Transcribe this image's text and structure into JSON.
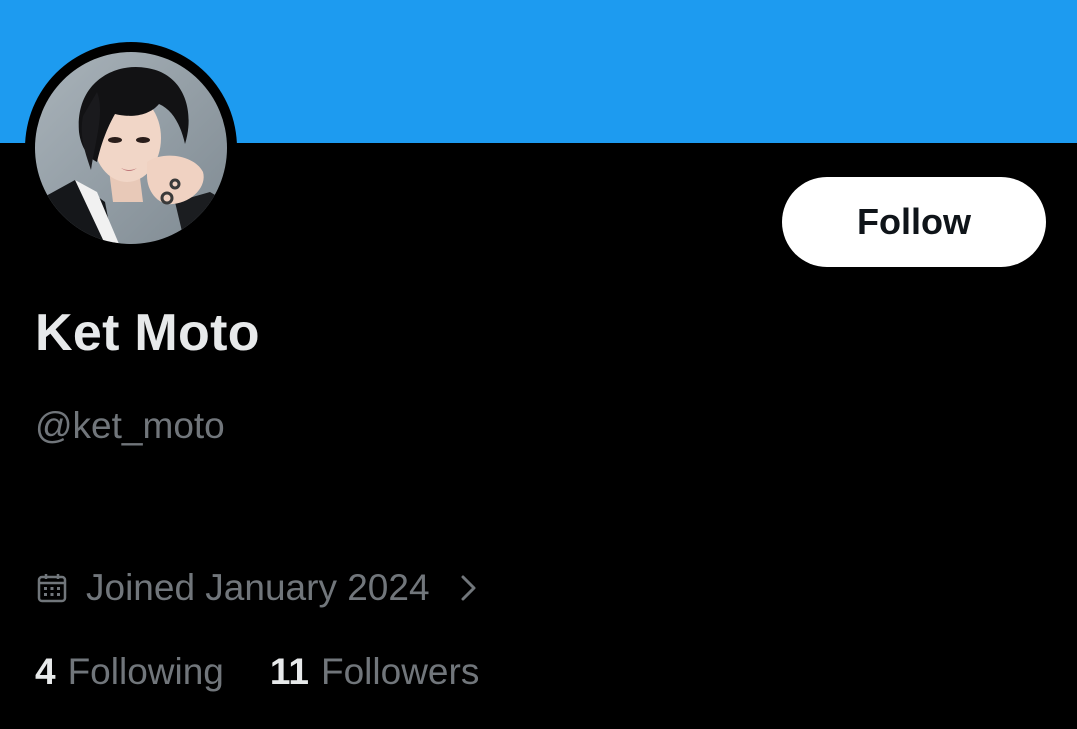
{
  "theme": {
    "banner_color": "#1d9bf0",
    "background_color": "#000000",
    "primary_text_color": "#e7e9ea",
    "secondary_text_color": "#71767b",
    "follow_button_bg": "#ffffff",
    "follow_button_text": "#0f1419"
  },
  "profile": {
    "display_name": "Ket Moto",
    "handle": "@ket_moto",
    "avatar_icon": "profile-photo",
    "joined": {
      "icon": "calendar-icon",
      "text": "Joined January 2024",
      "chevron_icon": "chevron-right-icon"
    }
  },
  "actions": {
    "follow_label": "Follow"
  },
  "stats": {
    "following": {
      "count": "4",
      "label": "Following"
    },
    "followers": {
      "count": "11",
      "label": "Followers"
    }
  }
}
